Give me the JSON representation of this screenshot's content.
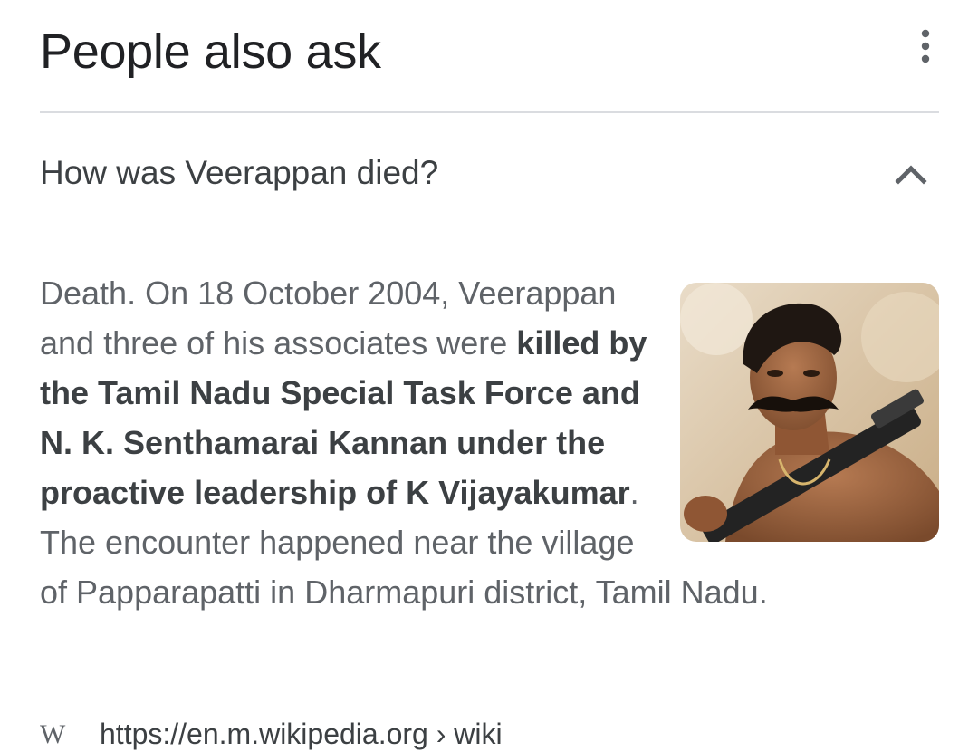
{
  "section": {
    "title": "People also ask",
    "more_icon": "more-vert-icon"
  },
  "question": {
    "text": "How was Veerappan died?",
    "expanded_icon": "chevron-up-icon"
  },
  "answer": {
    "part1": "Death. On 18 October 2004, Veerappan and three of his associates were ",
    "bold": "killed by the Tamil Nadu Special Task Force and N. K. Senthamarai Kannan under the proactive leadership of K Vijayakumar",
    "part2": ". The encounter happened near the village of Papparapatti in Dharmapuri district, Tamil Nadu.",
    "image_icon": "portrait-photo"
  },
  "source": {
    "site_icon": "W",
    "url": "https://en.m.wikipedia.org › wiki"
  },
  "colors": {
    "divider": "#dadce0",
    "title": "#202124",
    "body_text": "#5f6368",
    "bold_text": "#3c4043"
  }
}
